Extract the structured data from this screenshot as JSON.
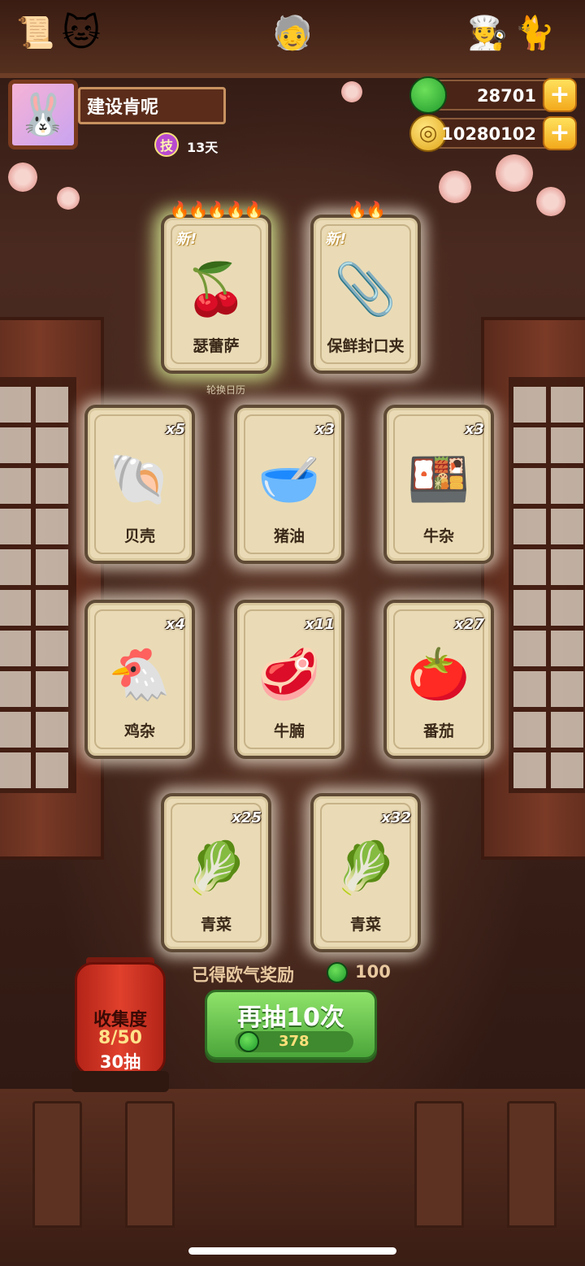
{
  "profile": {
    "name": "建设肯呢",
    "skill_badge": "技",
    "days": "13天",
    "avatar_icon": "🐰"
  },
  "currencies": {
    "apples": "28701",
    "coins": "10280102",
    "plus": "+"
  },
  "calendar_label": "轮换日历",
  "cards": [
    {
      "label": "瑟蕾萨",
      "icon": "🍒",
      "badge": "新!",
      "flames": "🔥🔥🔥🔥🔥",
      "count": ""
    },
    {
      "label": "保鲜封口夹",
      "icon": "📎",
      "badge": "新!",
      "flames": "🔥🔥",
      "count": ""
    },
    {
      "label": "贝壳",
      "icon": "🐚",
      "count": "x5"
    },
    {
      "label": "猪油",
      "icon": "🥣",
      "count": "x3"
    },
    {
      "label": "牛杂",
      "icon": "🍱",
      "count": "x3"
    },
    {
      "label": "鸡杂",
      "icon": "🐔",
      "count": "x4"
    },
    {
      "label": "牛腩",
      "icon": "🥩",
      "count": "x11"
    },
    {
      "label": "番茄",
      "icon": "🍅",
      "count": "x27"
    },
    {
      "label": "青菜",
      "icon": "🥬",
      "count": "x25"
    },
    {
      "label": "青菜",
      "icon": "🥬",
      "count": "x32"
    }
  ],
  "reward": {
    "text": "已得欧气奖励",
    "value": "100"
  },
  "draw_button": {
    "label": "再抽10次",
    "cost": "378"
  },
  "collection": {
    "title": "收集度",
    "progress": "8/50",
    "draws": "30抽"
  }
}
